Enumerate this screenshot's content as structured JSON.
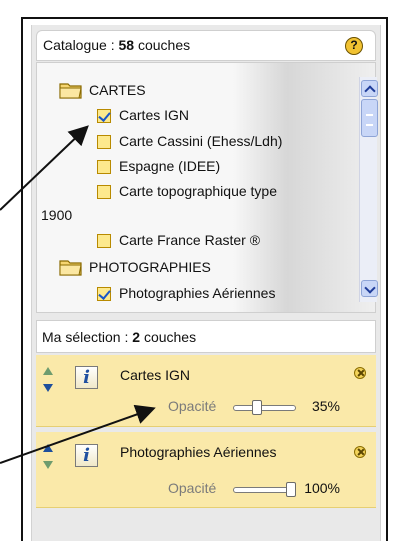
{
  "catalog": {
    "prefix": "Catalogue : ",
    "count": "58",
    "suffix": " couches",
    "help_symbol": "?"
  },
  "tree": {
    "folders": [
      {
        "label": "CARTES",
        "items": [
          {
            "label": "Cartes IGN",
            "checked": true
          },
          {
            "label": "Carte Cassini (Ehess/Ldh)",
            "checked": false
          },
          {
            "label": "Espagne (IDEE)",
            "checked": false
          },
          {
            "label": "Carte topographique type",
            "label_line2": "1900",
            "checked": false
          },
          {
            "label": "Carte France Raster ®",
            "checked": false
          }
        ]
      },
      {
        "label": "PHOTOGRAPHIES",
        "items": [
          {
            "label": "Photographies Aériennes",
            "checked": true
          }
        ]
      }
    ]
  },
  "selection": {
    "prefix": "Ma sélection : ",
    "count": "2",
    "suffix": " couches",
    "layers": [
      {
        "name": "Cartes IGN",
        "opacity_label": "Opacité",
        "opacity": 35,
        "opacity_text": "35%"
      },
      {
        "name": "Photographies Aériennes",
        "opacity_label": "Opacité",
        "opacity": 100,
        "opacity_text": "100%"
      }
    ]
  },
  "colors": {
    "selected_layer_bg": "#fae9a9",
    "checkbox_fill": "#fde98d",
    "info_icon": "#1f4fa0",
    "scrollbar": "#c8d6f7"
  },
  "icons": [
    "help-icon",
    "folder-icon",
    "checkbox-icon",
    "scroll-up-icon",
    "scroll-down-icon",
    "move-up-icon",
    "move-down-icon",
    "info-icon",
    "close-icon"
  ]
}
